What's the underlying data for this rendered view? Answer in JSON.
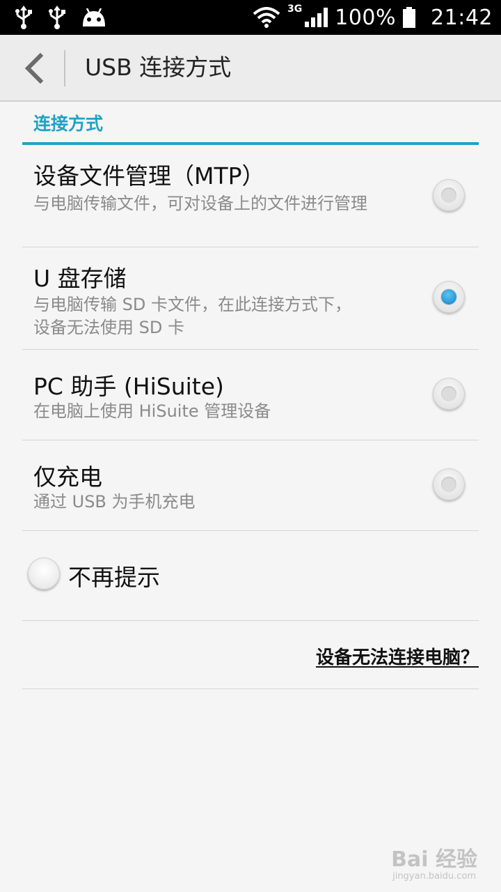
{
  "status_bar": {
    "icons_left": [
      "usb-icon",
      "usb-icon",
      "android-icon"
    ],
    "network": "3G",
    "battery": "100%",
    "time": "21:42"
  },
  "action_bar": {
    "title": "USB 连接方式"
  },
  "section": {
    "header": "连接方式"
  },
  "options": [
    {
      "title": "设备文件管理（MTP）",
      "subtitle": "与电脑传输文件，可对设备上的文件进行管理",
      "checked": false
    },
    {
      "title": "U 盘存储",
      "subtitle": "与电脑传输 SD 卡文件，在此连接方式下，设备无法使用 SD 卡",
      "checked": true
    },
    {
      "title": "PC 助手 (HiSuite)",
      "subtitle": "在电脑上使用 HiSuite 管理设备",
      "checked": false
    },
    {
      "title": "仅充电",
      "subtitle": "通过 USB 为手机充电",
      "checked": false
    }
  ],
  "dont_remind": {
    "label": "不再提示",
    "checked": false
  },
  "help_link": "设备无法连接电脑？",
  "watermark": {
    "main": "Bai 经验",
    "sub": "jingyan.baidu.com"
  },
  "colors": {
    "accent": "#1fa3c4",
    "radio_checked": "#2596d8"
  }
}
